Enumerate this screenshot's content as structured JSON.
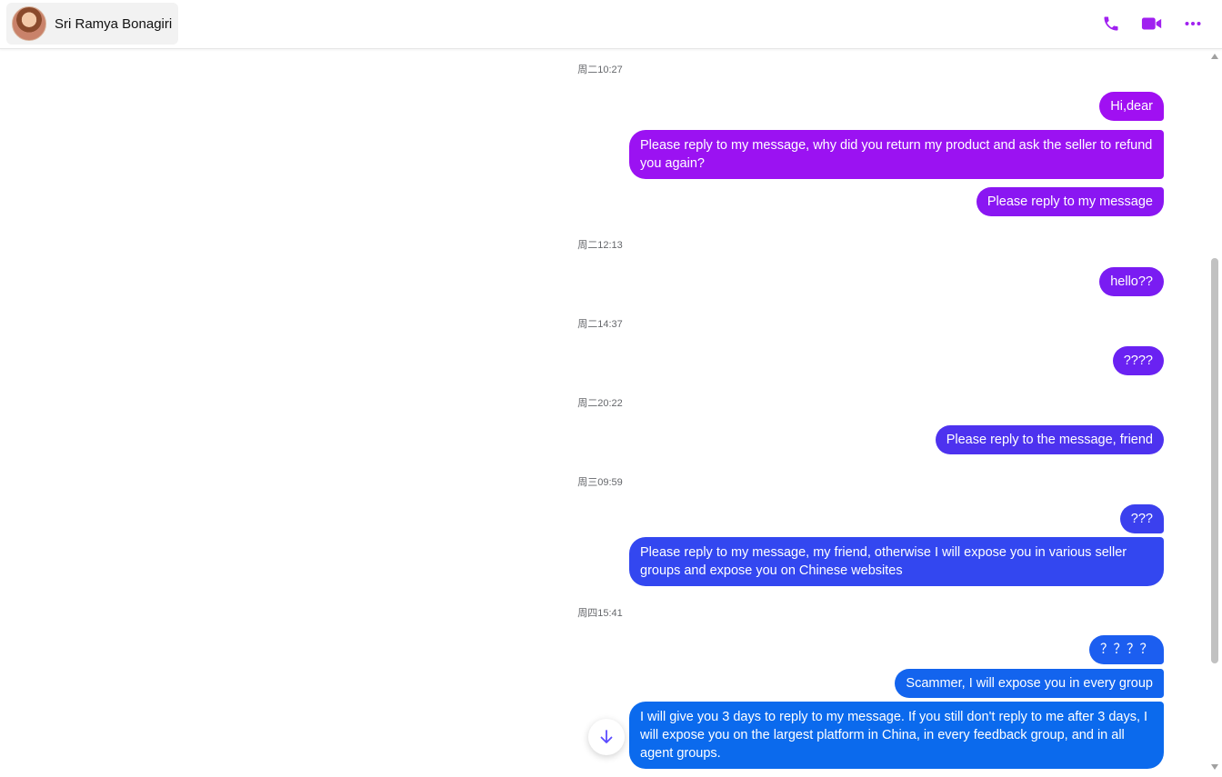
{
  "contact": {
    "name": "Sri Ramya Bonagiri"
  },
  "header_icons": [
    "phone-icon",
    "video-camera-icon",
    "more-icon"
  ],
  "accent_color": "#a020f0",
  "timestamps": [
    "周二10:27",
    "周二12:13",
    "周二14:37",
    "周二20:22",
    "周三09:59",
    "周四15:41"
  ],
  "messages": [
    "Hi,dear",
    "Please reply to my message, why did you return my product and ask the seller to refund you again?",
    "Please reply to my message",
    "hello??",
    "????",
    "Please reply to the message, friend",
    "???",
    "Please reply to my message, my friend, otherwise I will expose you in various seller groups and expose you on Chinese websites",
    "？？？？",
    "Scammer, I will expose you in every group",
    "I will give you 3 days to reply to my message. If you still don't reply to me after 3 days, I will expose you on the largest platform in China, in every feedback group, and in all agent groups."
  ],
  "bubble_colors": [
    "#a010f2",
    "#9b12f2",
    "#8a16f2",
    "#7a1cf2",
    "#6a22f2",
    "#4d32ef",
    "#3b40ee",
    "#3347f0",
    "#1c5ef0",
    "#1364ee",
    "#0b6aed"
  ],
  "scroll_down_icon": "arrow-down-icon"
}
